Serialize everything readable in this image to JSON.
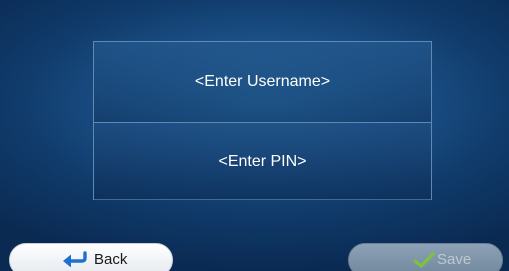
{
  "form": {
    "username_placeholder": "<Enter Username>",
    "pin_placeholder": "<Enter PIN>"
  },
  "buttons": {
    "back_label": "Back",
    "back_icon": "back-arrow-icon",
    "save_label": "Save",
    "save_icon": "checkmark-icon",
    "save_enabled": false
  },
  "colors": {
    "background": "#1b4f86",
    "field_border": "#5f88b3",
    "back_arrow": "#1f6fd1",
    "save_check": "#7dc142"
  }
}
